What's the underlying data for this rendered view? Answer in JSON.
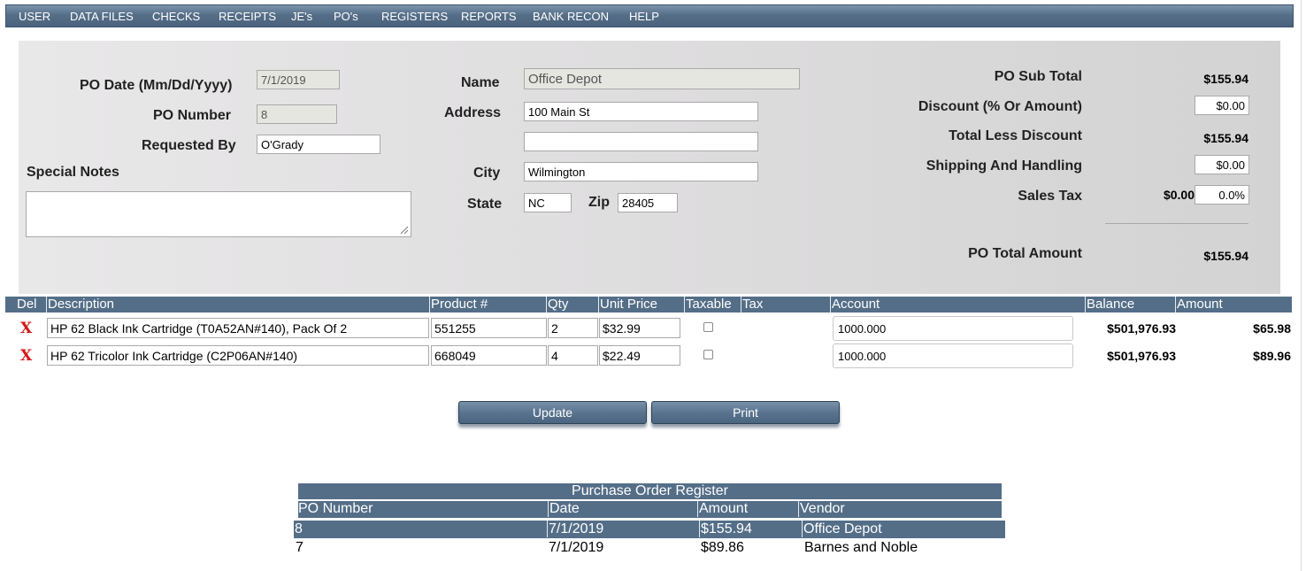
{
  "menu": {
    "items": [
      {
        "label": "USER"
      },
      {
        "label": "DATA FILES"
      },
      {
        "label": "CHECKS"
      },
      {
        "label": "RECEIPTS"
      },
      {
        "label": "JE's"
      },
      {
        "label": "PO's"
      },
      {
        "label": "REGISTERS"
      },
      {
        "label": "REPORTS"
      },
      {
        "label": "BANK RECON"
      },
      {
        "label": "HELP"
      }
    ]
  },
  "po_form": {
    "po_date": {
      "label": "PO Date (Mm/Dd/Yyyy)",
      "value": "7/1/2019"
    },
    "po_number": {
      "label": "PO Number",
      "value": "8"
    },
    "requested_by": {
      "label": "Requested By",
      "value": "O'Grady"
    },
    "special_notes": {
      "label": "Special Notes",
      "value": ""
    },
    "name": {
      "label": "Name",
      "value": "Office Depot"
    },
    "address": {
      "label": "Address",
      "line1": "100 Main St",
      "line2": ""
    },
    "city": {
      "label": "City",
      "value": "Wilmington"
    },
    "state": {
      "label": "State",
      "value": "NC"
    },
    "zip": {
      "label": "Zip",
      "value": "28405"
    }
  },
  "totals": {
    "sub_total": {
      "label": "PO Sub Total",
      "value": "$155.94"
    },
    "discount": {
      "label": "Discount (% Or Amount)",
      "value": "$0.00"
    },
    "total_less_discount": {
      "label": "Total Less Discount",
      "value": "$155.94"
    },
    "shipping": {
      "label": "Shipping And Handling",
      "value": "$0.00"
    },
    "sales_tax": {
      "label": "Sales Tax",
      "amount": "$0.00",
      "rate": "0.0%"
    },
    "po_total": {
      "label": "PO Total Amount",
      "value": "$155.94"
    }
  },
  "line_items": {
    "headers": {
      "del": "Del",
      "description": "Description",
      "product": "Product #",
      "qty": "Qty",
      "unit_price": "Unit Price",
      "taxable": "Taxable",
      "tax": "Tax",
      "account": "Account",
      "balance": "Balance",
      "amount": "Amount"
    },
    "delete_glyph": "X",
    "rows": [
      {
        "description": "HP 62 Black Ink Cartridge (T0A52AN#140), Pack Of 2",
        "product": "551255",
        "qty": "2",
        "unit_price": "$32.99",
        "taxable": false,
        "account": "1000.000",
        "balance": "$501,976.93",
        "amount": "$65.98"
      },
      {
        "description": "HP 62 Tricolor Ink Cartridge (C2P06AN#140)",
        "product": "668049",
        "qty": "4",
        "unit_price": "$22.49",
        "taxable": false,
        "account": "1000.000",
        "balance": "$501,976.93",
        "amount": "$89.96"
      }
    ]
  },
  "buttons": {
    "update": "Update",
    "print": "Print"
  },
  "register": {
    "title": "Purchase Order Register",
    "headers": {
      "po_number": "PO Number",
      "date": "Date",
      "amount": "Amount",
      "vendor": "Vendor"
    },
    "rows": [
      {
        "po_number": "8",
        "date": "7/1/2019",
        "amount": "$155.94",
        "vendor": "Office Depot",
        "selected": true
      },
      {
        "po_number": "7",
        "date": "7/1/2019",
        "amount": "$89.86",
        "vendor": "Barnes and Noble",
        "selected": false
      }
    ]
  },
  "colors": {
    "menu_bar": "#566f89",
    "header_bar": "#546e88",
    "delete_red": "#d51818",
    "panel": "#dcdbdc"
  }
}
